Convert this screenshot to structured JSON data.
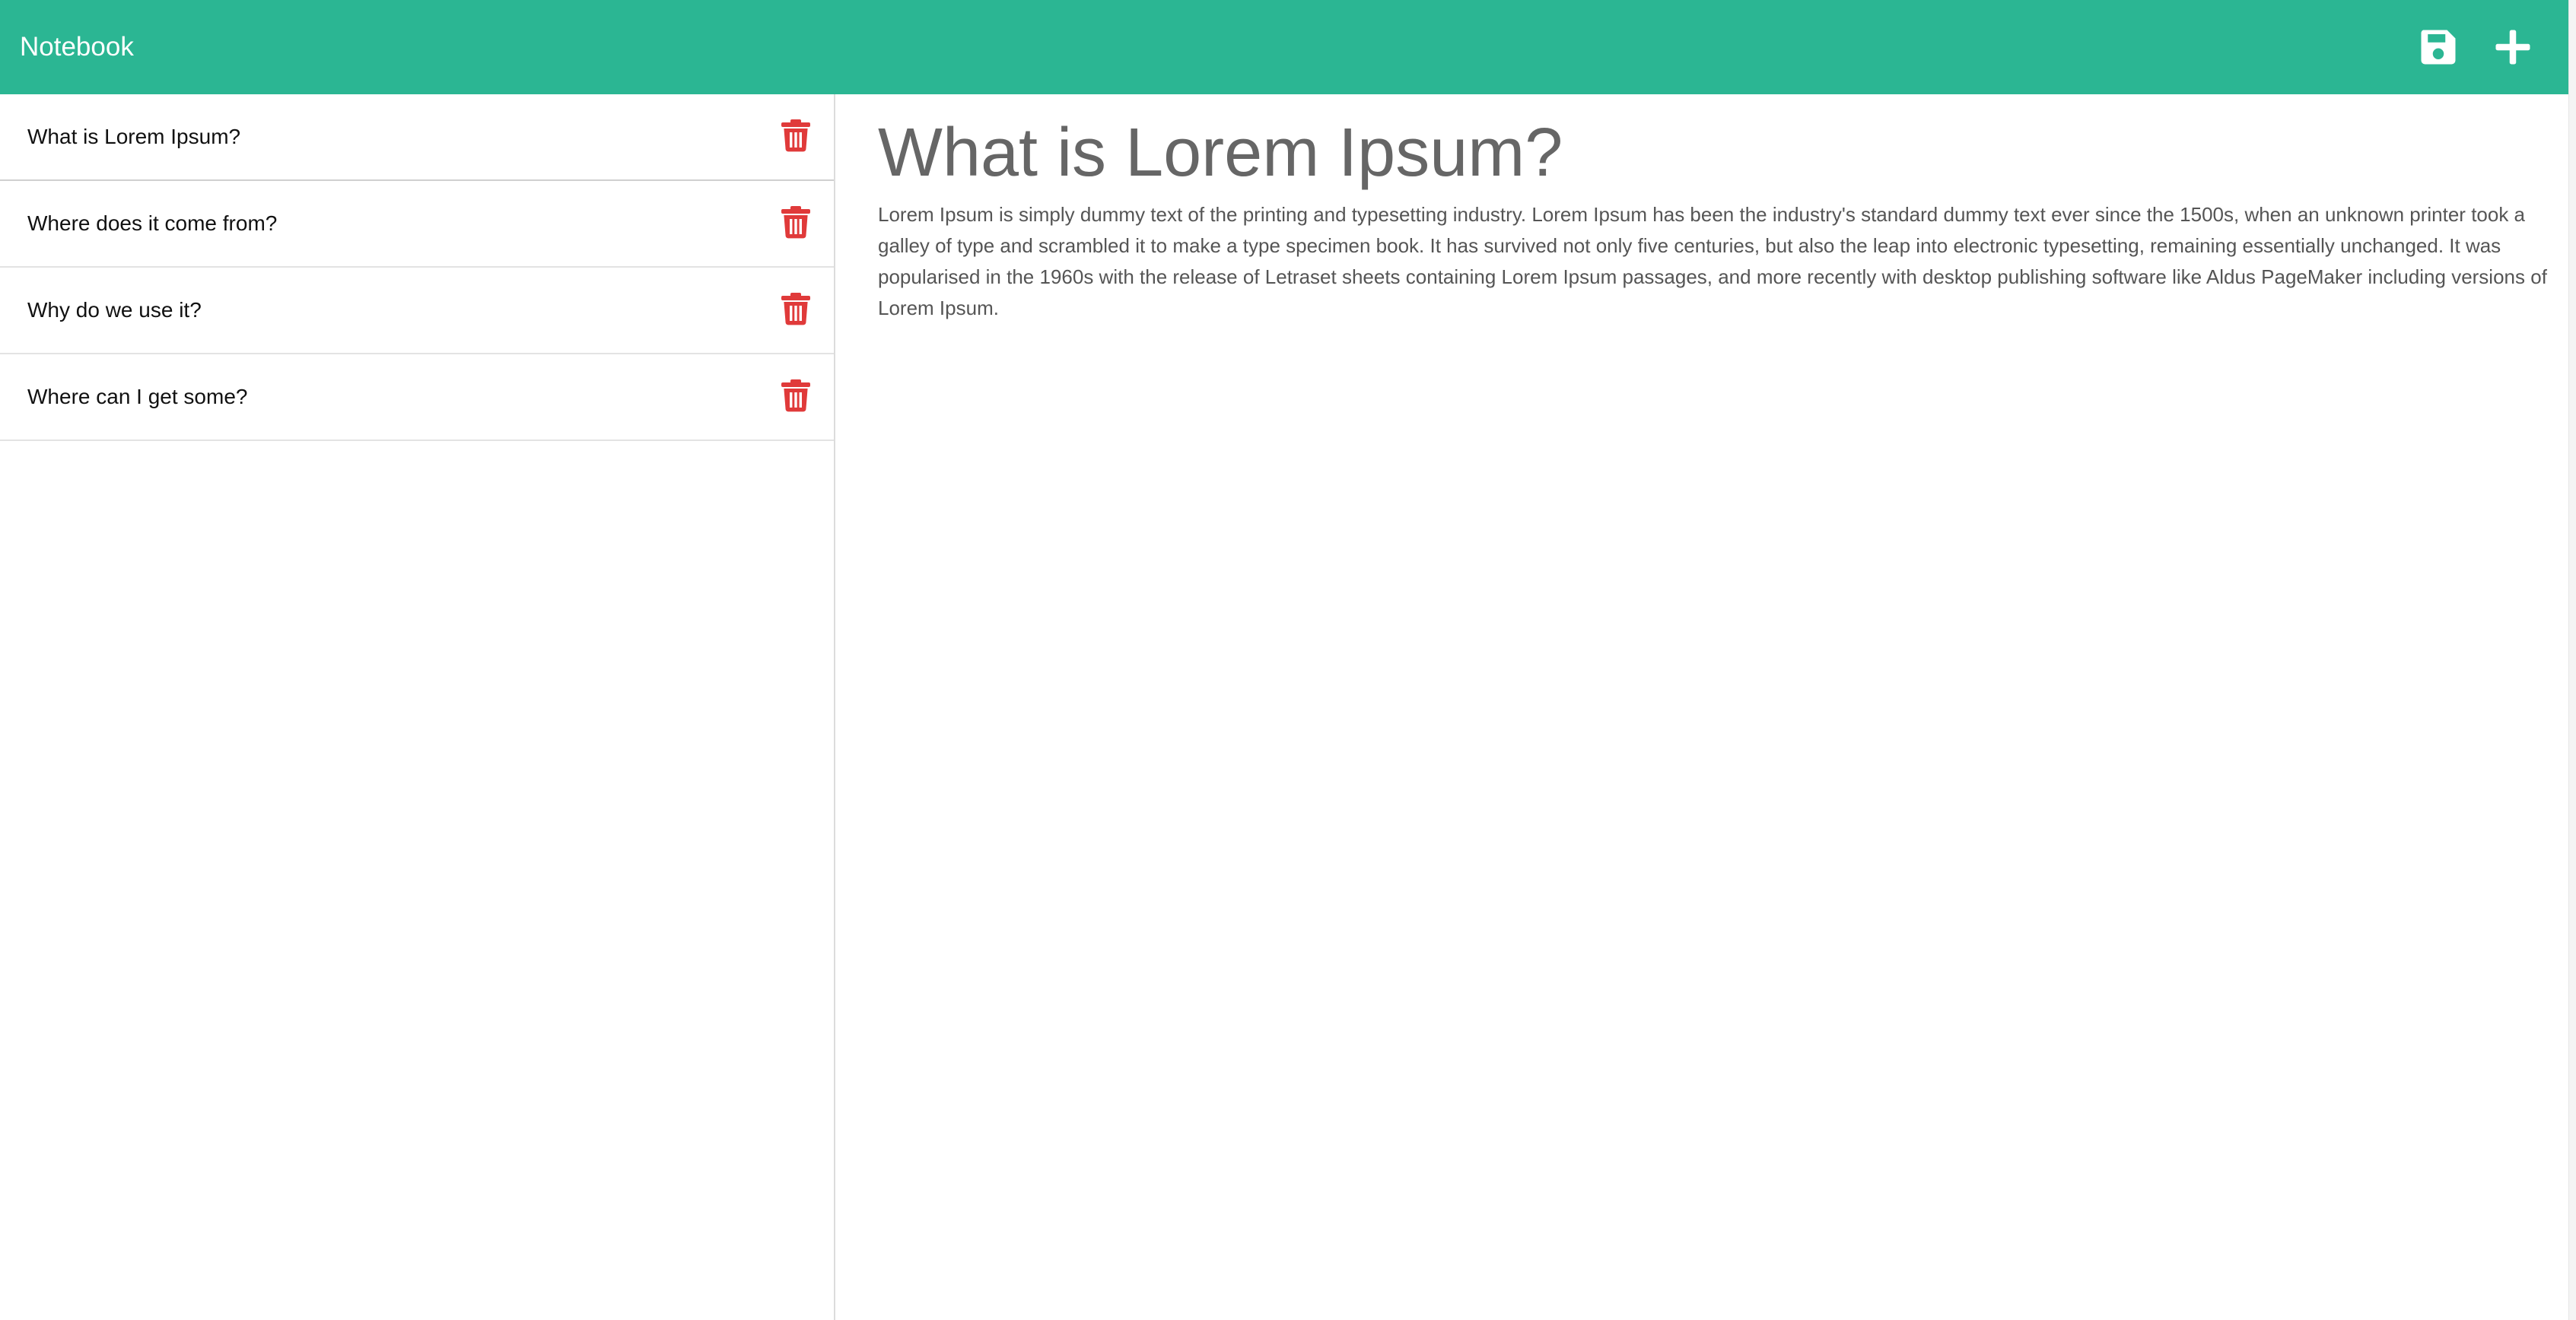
{
  "app": {
    "title": "Notebook"
  },
  "toolbar": {
    "save_icon": "floppy-disk-icon",
    "add_icon": "plus-icon"
  },
  "colors": {
    "navbar": "#2bb693",
    "delete": "#e03a3a",
    "heading": "#666666"
  },
  "notes": [
    {
      "title": "What is Lorem Ipsum?",
      "delete_icon": "trash-icon"
    },
    {
      "title": "Where does it come from?",
      "delete_icon": "trash-icon"
    },
    {
      "title": "Why do we use it?",
      "delete_icon": "trash-icon"
    },
    {
      "title": "Where can I get some?",
      "delete_icon": "trash-icon"
    }
  ],
  "active_note": {
    "title": "What is Lorem Ipsum?",
    "text": "Lorem Ipsum is simply dummy text of the printing and typesetting industry. Lorem Ipsum has been the industry's standard dummy text ever since the 1500s, when an unknown printer took a galley of type and scrambled it to make a type specimen book. It has survived not only five centuries, but also the leap into electronic typesetting, remaining essentially unchanged. It was popularised in the 1960s with the release of Letraset sheets containing Lorem Ipsum passages, and more recently with desktop publishing software like Aldus PageMaker including versions of Lorem Ipsum."
  }
}
